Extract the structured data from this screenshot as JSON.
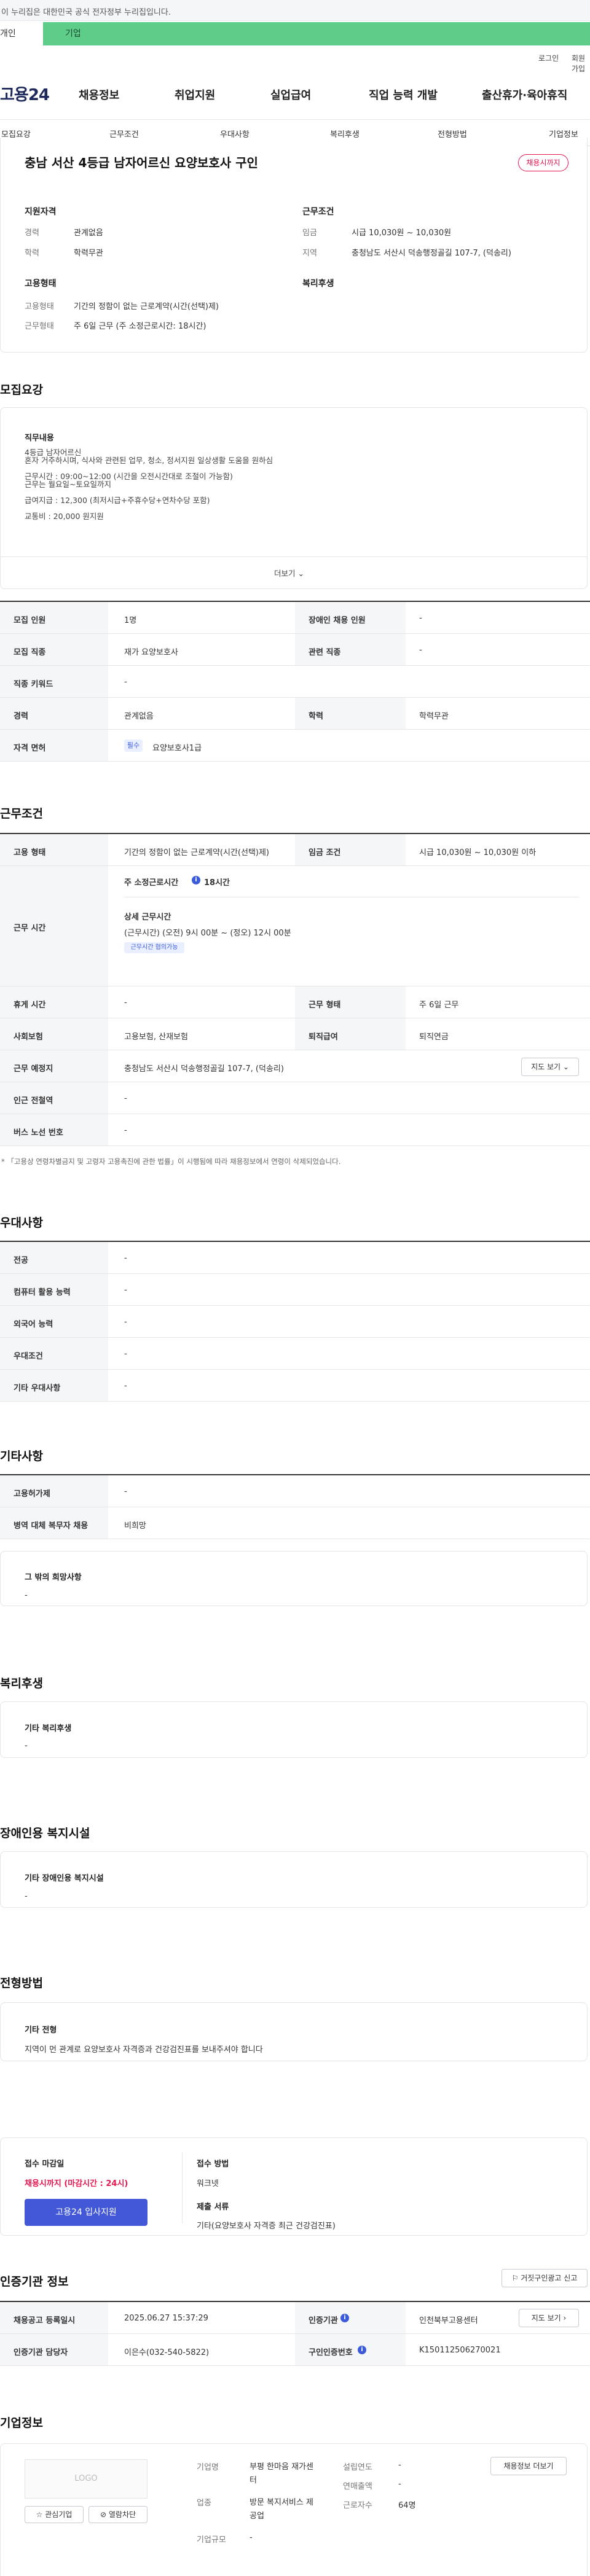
{
  "gov_banner": "이 누리집은 대한민국 공식 전자정부 누리집입니다.",
  "user_tabs": {
    "person": "개인",
    "corp": "기업"
  },
  "util": {
    "login": "로그인",
    "signup": "회원가입"
  },
  "logo": "고용24",
  "gnb": [
    "채용정보",
    "취업지원",
    "실업급여",
    "직업 능력 개발",
    "출산휴가·육아휴직"
  ],
  "subnav": [
    "모집요강",
    "근무조건",
    "우대사항",
    "복리후생",
    "전형방법",
    "기업정보"
  ],
  "job": {
    "title": "충남 서산 4등급 남자어르신 요양보호사 구인",
    "status": "채용시까지",
    "qual_heading": "지원자격",
    "career_label": "경력",
    "career_value": "관계없음",
    "edu_label": "학력",
    "edu_value": "학력무관",
    "cond_heading": "근무조건",
    "wage_label": "임금",
    "wage_value": "시급 10,030원 ~ 10,030원",
    "place_label": "지역",
    "place_value": "충청남도 서산시 덕송행정골길 107-7, (덕송리)",
    "emp_heading": "고용형태",
    "emp_type_label": "고용형태",
    "emp_type_value": "기간의 정함이 없는 근로계약(시간(선택)제)",
    "work_type_label": "근무형태",
    "work_type_value": "주 6일 근무 (주 소정근로시간: 18시간)",
    "welfare_heading": "복리후생"
  },
  "recruit": {
    "title": "모집요강",
    "duty_heading": "직무내용",
    "duty_lines": [
      "4등급 남자어르신",
      "혼자 거주하시며, 식사와 관련된 업무, 청소, 정서지원 일상생활 도움을 원하심",
      "",
      "근무시간 : 09:00~12:00 (시간을 오전시간대로 조절이 가능함)",
      "근무는 월요일~토요일까지",
      "",
      "급여지급 : 12,300 (최저시급+주휴수당+연차수당 포함)",
      "",
      "교통비 : 20,000 원지원"
    ],
    "more_button": "더보기",
    "rows": [
      {
        "k1": "모집 인원",
        "v1": "1명",
        "k2": "장애인 채용 인원",
        "v2": "-"
      },
      {
        "k1": "모집 직종",
        "v1": "재가 요양보호사",
        "k2": "관련 직종",
        "v2": "-"
      },
      {
        "k1": "직종 키워드",
        "v1": "-"
      },
      {
        "k1": "경력",
        "v1": "관계없음",
        "k2": "학력",
        "v2": "학력무관"
      },
      {
        "k1": "자격 면허",
        "badge": "필수",
        "v1": "요양보호사1급"
      }
    ]
  },
  "work": {
    "title": "근무조건",
    "emp_label": "고용 형태",
    "emp_value": "기간의 정함이 없는 근로계약(시간(선택)제)",
    "wage_label": "임금 조건",
    "wage_value": "시급 10,030원 ~ 10,030원 이하",
    "time_label": "근무 시간",
    "weekly_hours_label": "주 소정근로시간",
    "weekly_hours_value": "18시간",
    "detail_heading": "상세 근무시간",
    "detail_value": "(근무시간) (오전) 9시 00분 ~ (정오) 12시 00분",
    "negotiable": "근무시간 협의가능",
    "break_label": "휴게 시간",
    "break_value": "-",
    "shape_label": "근무 형태",
    "shape_value": "주 6일 근무",
    "insurance_label": "사회보험",
    "insurance_value": "고용보험, 산재보험",
    "retire_label": "퇴직급여",
    "retire_value": "퇴직연금",
    "loc_label": "근무 예정지",
    "loc_value": "충청남도 서산시 덕송행정골길 107-7, (덕송리)",
    "map_button": "지도 보기",
    "subway_label": "인근 전철역",
    "subway_value": "-",
    "bus_label": "버스 노선 번호",
    "bus_value": "-",
    "notice": "「고용상 연령차별금지 및 고령자 고용촉진에 관한 법률」이 시행됨에 따라 채용정보에서 연령이 삭제되었습니다."
  },
  "pref": {
    "title": "우대사항",
    "rows": [
      {
        "k": "전공",
        "v": "-"
      },
      {
        "k": "컴퓨터 활용 능력",
        "v": "-"
      },
      {
        "k": "외국어 능력",
        "v": "-"
      },
      {
        "k": "우대조건",
        "v": "-"
      },
      {
        "k": "기타 우대사항",
        "v": "-"
      }
    ]
  },
  "etc": {
    "title": "기타사항",
    "rows": [
      {
        "k": "고용허가제",
        "v": "-"
      },
      {
        "k": "병역 대체 복무자 채용",
        "v": "비희망"
      }
    ],
    "other_heading": "그 밖의 희망사항",
    "other_value": "-"
  },
  "welfare": {
    "title": "복리후생",
    "heading": "기타 복리후생",
    "value": "-"
  },
  "disabled": {
    "title": "장애인용 복지시설",
    "heading": "기타 장애인용 복지시설",
    "value": "-"
  },
  "process": {
    "title": "전형방법",
    "other_heading": "기타 전형",
    "other_value": "지역이 먼 관계로 요양보호사 자격증과 건강검진표를 보내주셔야 합니다",
    "deadline_heading": "접수 마감일",
    "deadline_value": "채용시까지 (마감시간 : 24시)",
    "apply_button": "고용24 입사지원",
    "method_heading": "접수 방법",
    "method_value": "워크넷",
    "docs_heading": "제출 서류",
    "docs_value": "기타(요양보호사 자격증 최근 건강검진표)"
  },
  "agency": {
    "title": "인증기관 정보",
    "report_button": "거짓구인광고 신고",
    "reg_date_label": "채용공고 등록일시",
    "reg_date_value": "2025.06.27 15:37:29",
    "agency_label": "인증기관",
    "agency_value": "인천북부고용센터",
    "map_button": "지도 보기",
    "manager_label": "인증기관 담당자",
    "manager_value": "이은수(032-540-5822)",
    "cert_label": "구인인증번호",
    "cert_value": "K150112506270021"
  },
  "company": {
    "title": "기업정보",
    "logo_text": "LOGO",
    "interest_button": "관심기업",
    "block_button": "열람차단",
    "name_label": "기업명",
    "name_value": "부평 한마음 재가센터",
    "industry_label": "업종",
    "industry_value": "방문 복지서비스 제공업",
    "size_label": "기업규모",
    "size_value": "-",
    "founded_label": "설립연도",
    "founded_value": "-",
    "sales_label": "연매출액",
    "sales_value": "-",
    "workers_label": "근로자수",
    "workers_value": "64명",
    "jobs_button": "채용정보 더보기"
  }
}
